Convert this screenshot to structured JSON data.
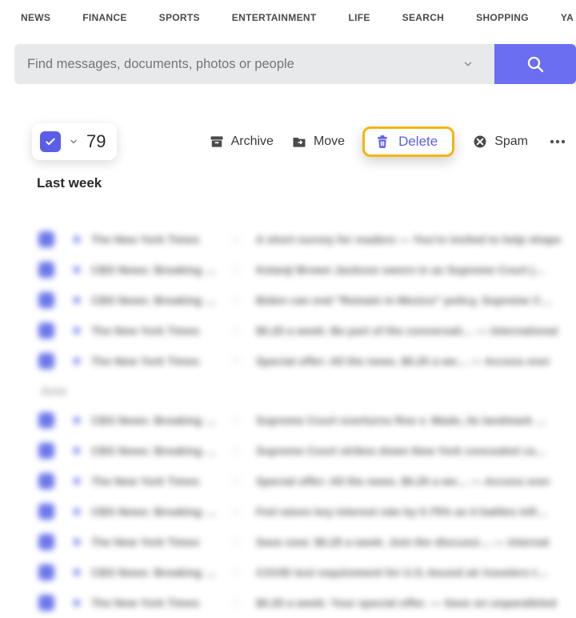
{
  "topnav": {
    "items": [
      "NEWS",
      "FINANCE",
      "SPORTS",
      "ENTERTAINMENT",
      "LIFE",
      "SEARCH",
      "SHOPPING",
      "YA"
    ]
  },
  "search": {
    "placeholder": "Find messages, documents, photos or people"
  },
  "toolbar": {
    "selected_count": "79",
    "archive_label": "Archive",
    "move_label": "Move",
    "delete_label": "Delete",
    "spam_label": "Spam"
  },
  "sections": {
    "last_week": "Last week",
    "june": "June"
  },
  "messages_last_week": [
    {
      "sender": "The New York Times",
      "subject": "A short survey for readers — You're invited to help shape"
    },
    {
      "sender": "CBS News: Breaking …",
      "subject": "Ketanji Brown Jackson sworn in as Supreme Court j…"
    },
    {
      "sender": "CBS News: Breaking …",
      "subject": "Biden can end \"Remain in Mexico\" policy, Supreme C…"
    },
    {
      "sender": "The New York Times",
      "subject": "$0.25 a week: Be part of the conversati… — International"
    },
    {
      "sender": "The New York Times",
      "subject": "Special offer: All the news. $0.25 a we… — Access ever"
    }
  ],
  "messages_june": [
    {
      "sender": "CBS News: Breaking …",
      "subject": "Supreme Court overturns Roe v. Wade, its landmark …"
    },
    {
      "sender": "CBS News: Breaking …",
      "subject": "Supreme Court strikes down New York concealed ca…"
    },
    {
      "sender": "The New York Times",
      "subject": "Special offer: All the news. $0.25 a we… — Access ever"
    },
    {
      "sender": "CBS News: Breaking …",
      "subject": "Fed raises key interest rate by 0.75% as it battles infl…"
    },
    {
      "sender": "The New York Times",
      "subject": "Save now: $0.25 a week. Join the discussi… — Internat"
    },
    {
      "sender": "CBS News: Breaking …",
      "subject": "COVID test requirement for U.S.-bound air travelers t…"
    },
    {
      "sender": "The New York Times",
      "subject": "$0.25 a week: Your special offer. — Save on unparalleled"
    }
  ],
  "colors": {
    "accent": "#5a5ee6",
    "highlight_border": "#f6b40e"
  }
}
